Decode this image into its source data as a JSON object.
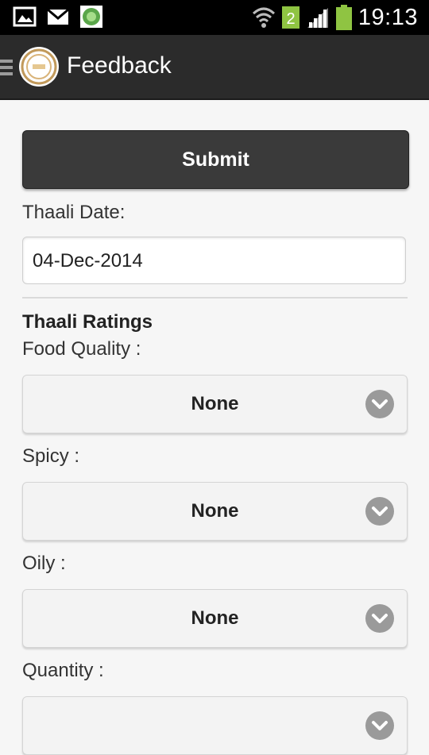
{
  "status_bar": {
    "time": "19:13",
    "notification_badge": "2",
    "icons": [
      "gallery-icon",
      "gmail-icon",
      "app-notification-icon",
      "wifi-icon",
      "signal-icon",
      "battery-icon"
    ]
  },
  "action_bar": {
    "title": "Feedback",
    "icons": [
      "menu-icon",
      "app-logo"
    ]
  },
  "form": {
    "submit_label": "Submit",
    "date_label": "Thaali Date:",
    "date_value": "04-Dec-2014",
    "ratings_title": "Thaali Ratings",
    "fields": [
      {
        "label": "Food Quality :",
        "value": "None"
      },
      {
        "label": "Spicy :",
        "value": "None"
      },
      {
        "label": "Oily :",
        "value": "None"
      },
      {
        "label": "Quantity :",
        "value": ""
      }
    ]
  },
  "colors": {
    "action_bar_bg": "#2b2b2b",
    "page_bg": "#f6f6f6",
    "button_bg": "#3a3a3a",
    "chevron_bg": "#9a9a9a"
  }
}
